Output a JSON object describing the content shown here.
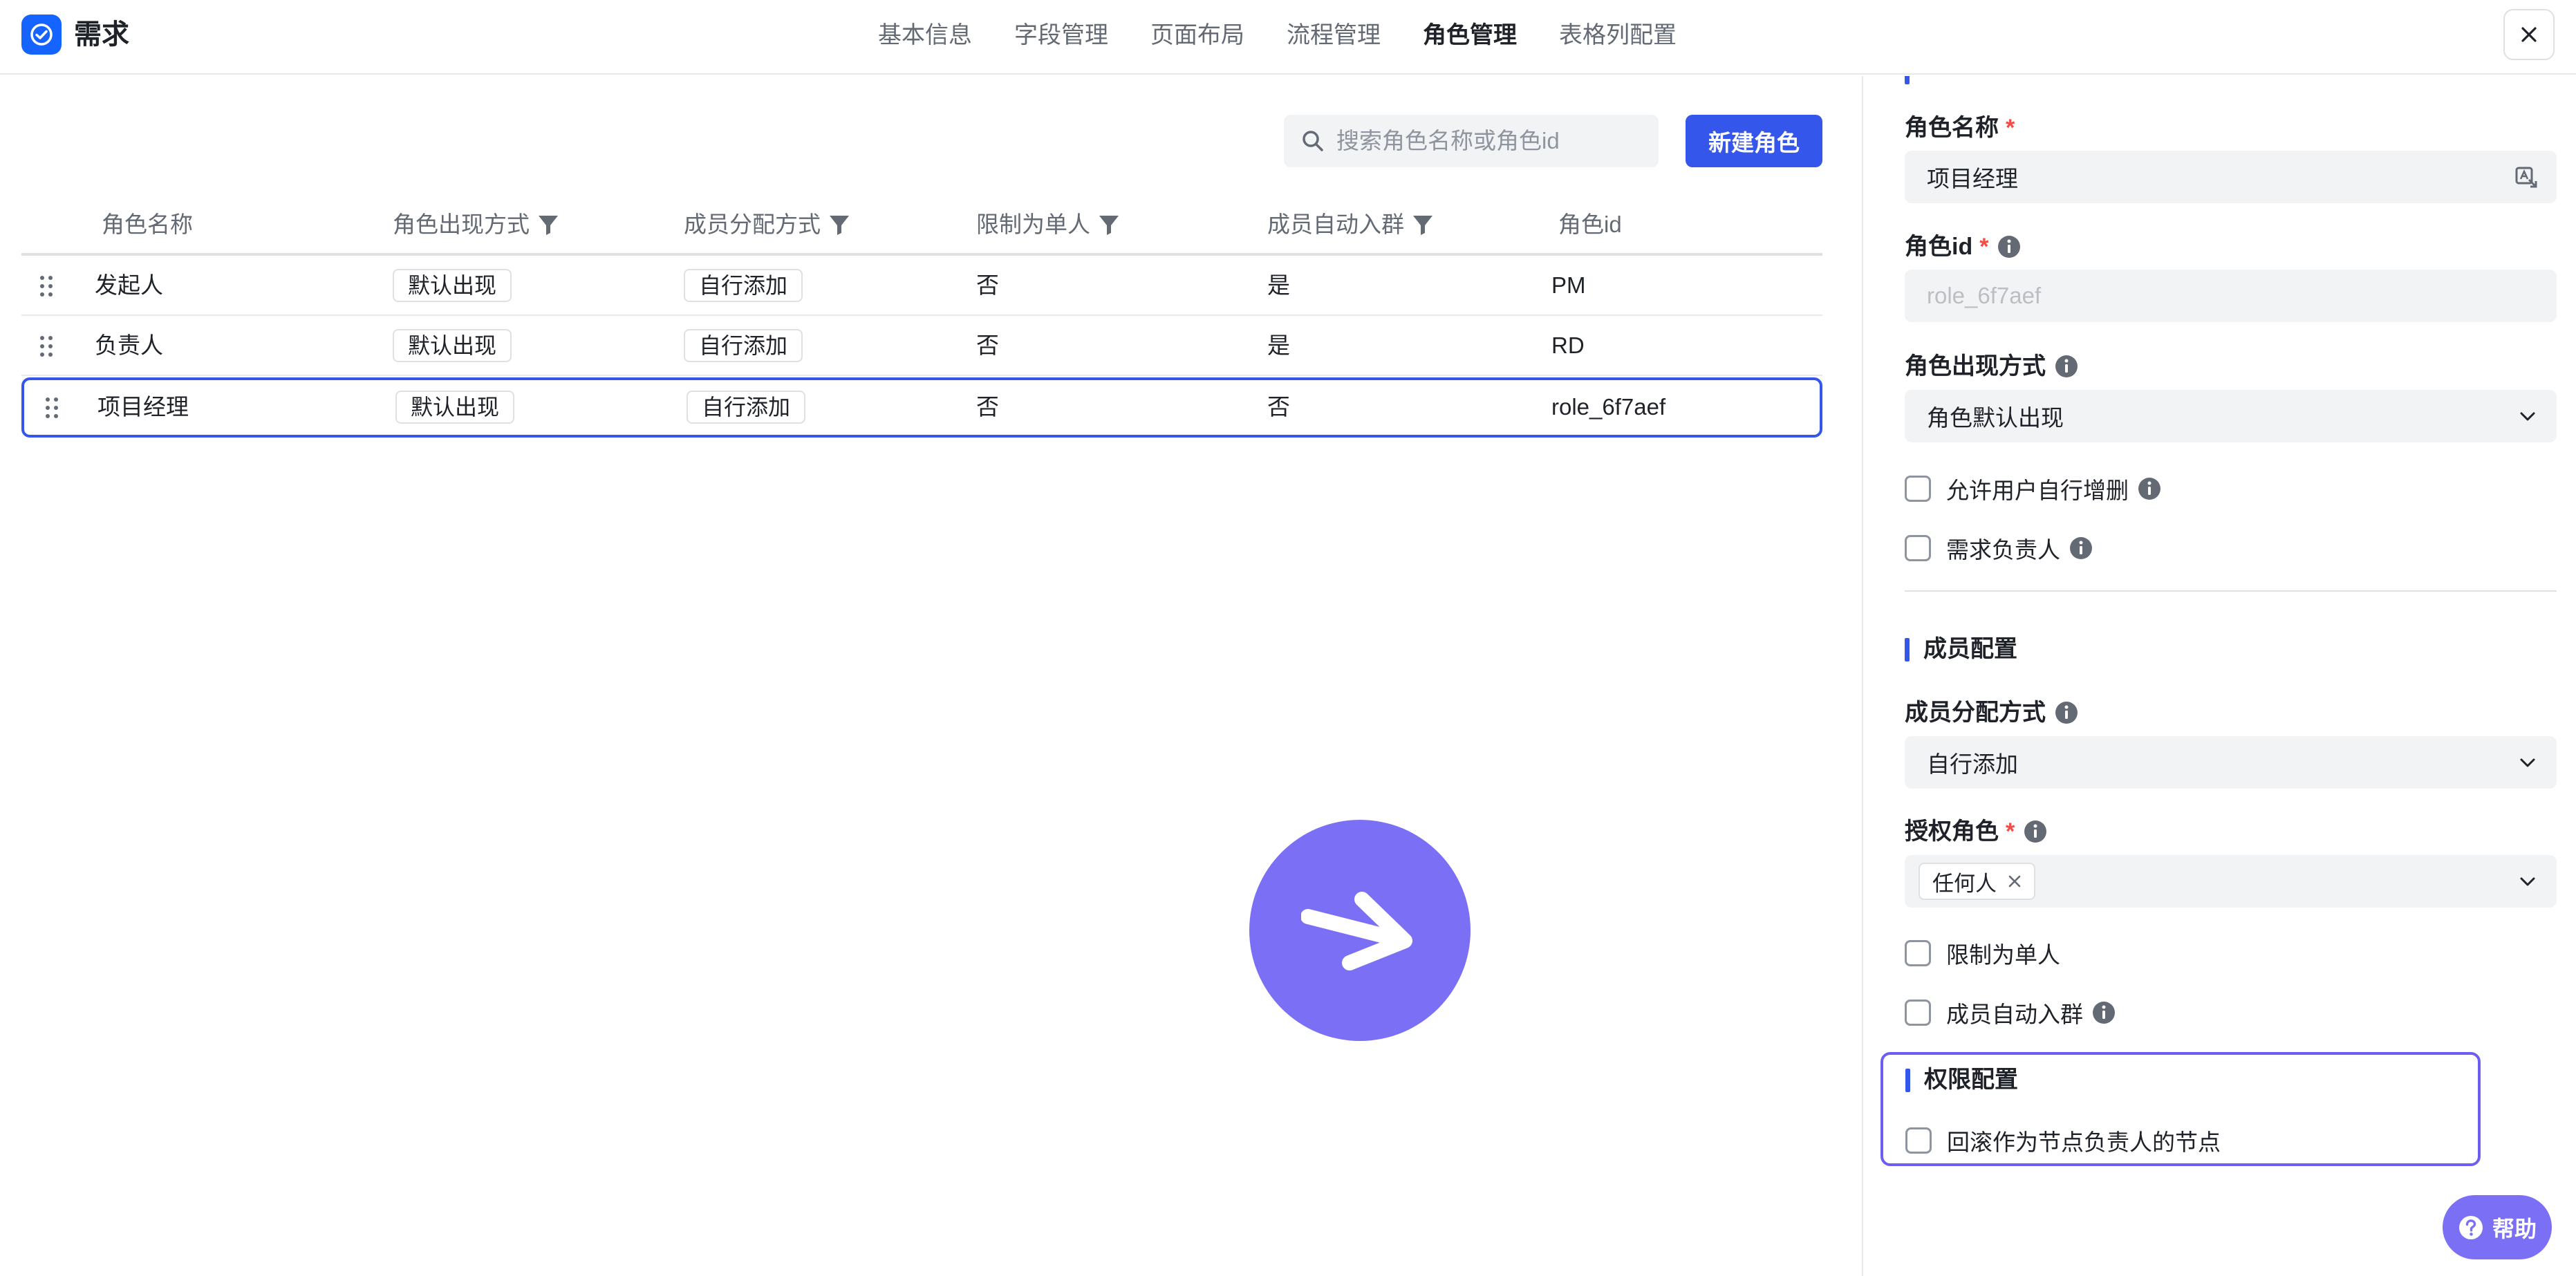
{
  "app": {
    "title": "需求"
  },
  "nav": {
    "tabs": [
      {
        "label": "基本信息"
      },
      {
        "label": "字段管理"
      },
      {
        "label": "页面布局"
      },
      {
        "label": "流程管理"
      },
      {
        "label": "角色管理"
      },
      {
        "label": "表格列配置"
      }
    ],
    "active_tab": "角色管理"
  },
  "toolbar": {
    "search_placeholder": "搜索角色名称或角色id",
    "new_role_label": "新建角色"
  },
  "table": {
    "columns": [
      "角色名称",
      "角色出现方式",
      "成员分配方式",
      "限制为单人",
      "成员自动入群",
      "角色id"
    ],
    "rows": [
      {
        "name": "发起人",
        "appear": "默认出现",
        "assign": "自行添加",
        "single": "否",
        "auto_group": "是",
        "id": "PM"
      },
      {
        "name": "负责人",
        "appear": "默认出现",
        "assign": "自行添加",
        "single": "否",
        "auto_group": "是",
        "id": "RD"
      },
      {
        "name": "项目经理",
        "appear": "默认出现",
        "assign": "自行添加",
        "single": "否",
        "auto_group": "否",
        "id": "role_6f7aef"
      }
    ],
    "selected_row": 2
  },
  "panel": {
    "role_name": {
      "label": "角色名称",
      "required": "*",
      "value": "项目经理"
    },
    "role_id": {
      "label": "角色id",
      "required": "*",
      "value": "role_6f7aef"
    },
    "appear_mode": {
      "label": "角色出现方式",
      "value": "角色默认出现"
    },
    "allow_user_edit": {
      "label": "允许用户自行增删"
    },
    "demand_owner": {
      "label": "需求负责人"
    },
    "member_section": {
      "title": "成员配置"
    },
    "assign_mode": {
      "label": "成员分配方式",
      "value": "自行添加"
    },
    "auth_role": {
      "label": "授权角色",
      "required": "*",
      "chip": "任何人"
    },
    "limit_single": {
      "label": "限制为单人"
    },
    "auto_join_group": {
      "label": "成员自动入群"
    },
    "permission_section": {
      "title": "权限配置"
    },
    "rollback_node": {
      "label": "回滚作为节点负责人的节点"
    }
  },
  "help": {
    "label": "帮助"
  },
  "colors": {
    "accent": "#3456eb",
    "brand": "#1664ff",
    "fab": "#7b70f5",
    "required": "#f54a45"
  }
}
